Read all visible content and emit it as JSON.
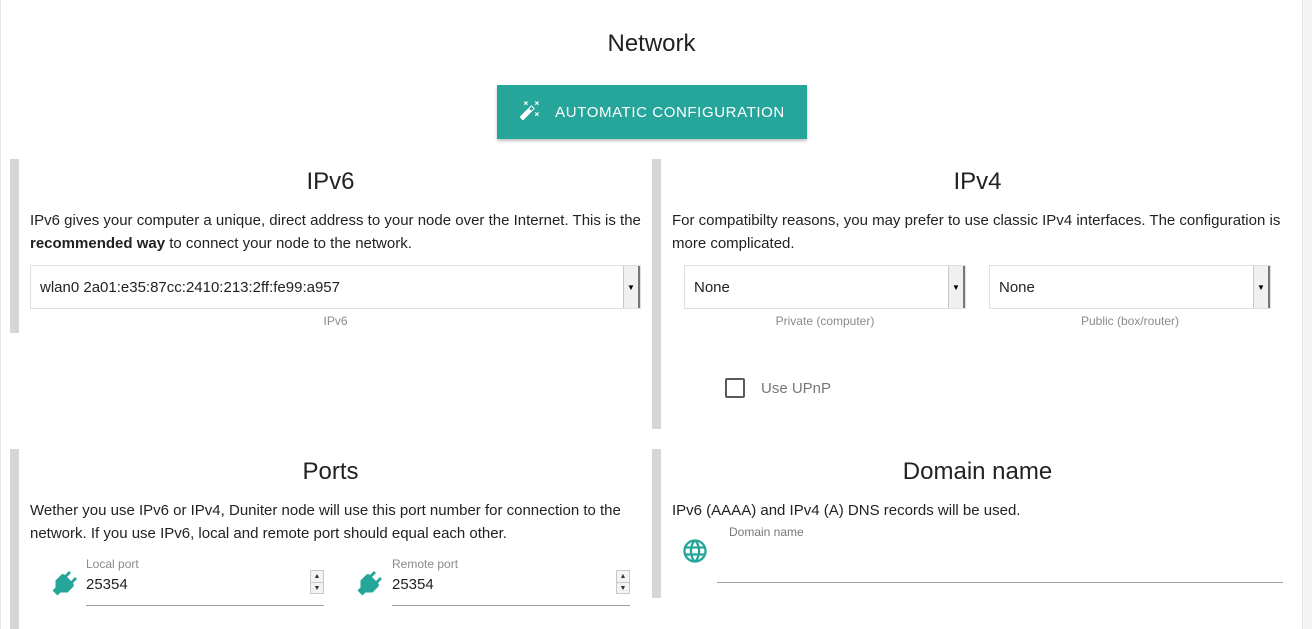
{
  "page": {
    "title": "Network"
  },
  "auto_config": {
    "label": "AUTOMATIC CONFIGURATION",
    "icon": "magic-wand-icon"
  },
  "ipv6": {
    "title": "IPv6",
    "text_pre": "IPv6 gives your computer a unique, direct address to your node over the Internet. This is the ",
    "text_bold": "recommended way",
    "text_post": " to connect your node to the network.",
    "select_value": "wlan0 2a01:e35:87cc:2410:213:2ff:fe99:a957",
    "select_caption": "IPv6"
  },
  "ipv4": {
    "title": "IPv4",
    "text": "For compatibilty reasons, you may prefer to use classic IPv4 interfaces. The configuration is more complicated.",
    "private": {
      "value": "None",
      "caption": "Private (computer)"
    },
    "public": {
      "value": "None",
      "caption": "Public (box/router)"
    },
    "upnp_label": "Use UPnP"
  },
  "ports": {
    "title": "Ports",
    "text": "Wether you use IPv6 or IPv4, Duniter node will use this port number for connection to the network. If you use IPv6, local and remote port should equal each other.",
    "local": {
      "label": "Local port",
      "value": "25354",
      "icon": "plug-icon"
    },
    "remote": {
      "label": "Remote port",
      "value": "25354",
      "icon": "plug-icon"
    }
  },
  "domain": {
    "title": "Domain name",
    "text": "IPv6 (AAAA) and IPv4 (A) DNS records will be used.",
    "field_label": "Domain name",
    "icon": "globe-icon"
  },
  "colors": {
    "accent": "#26a69a",
    "bar": "#d6d6d6"
  }
}
